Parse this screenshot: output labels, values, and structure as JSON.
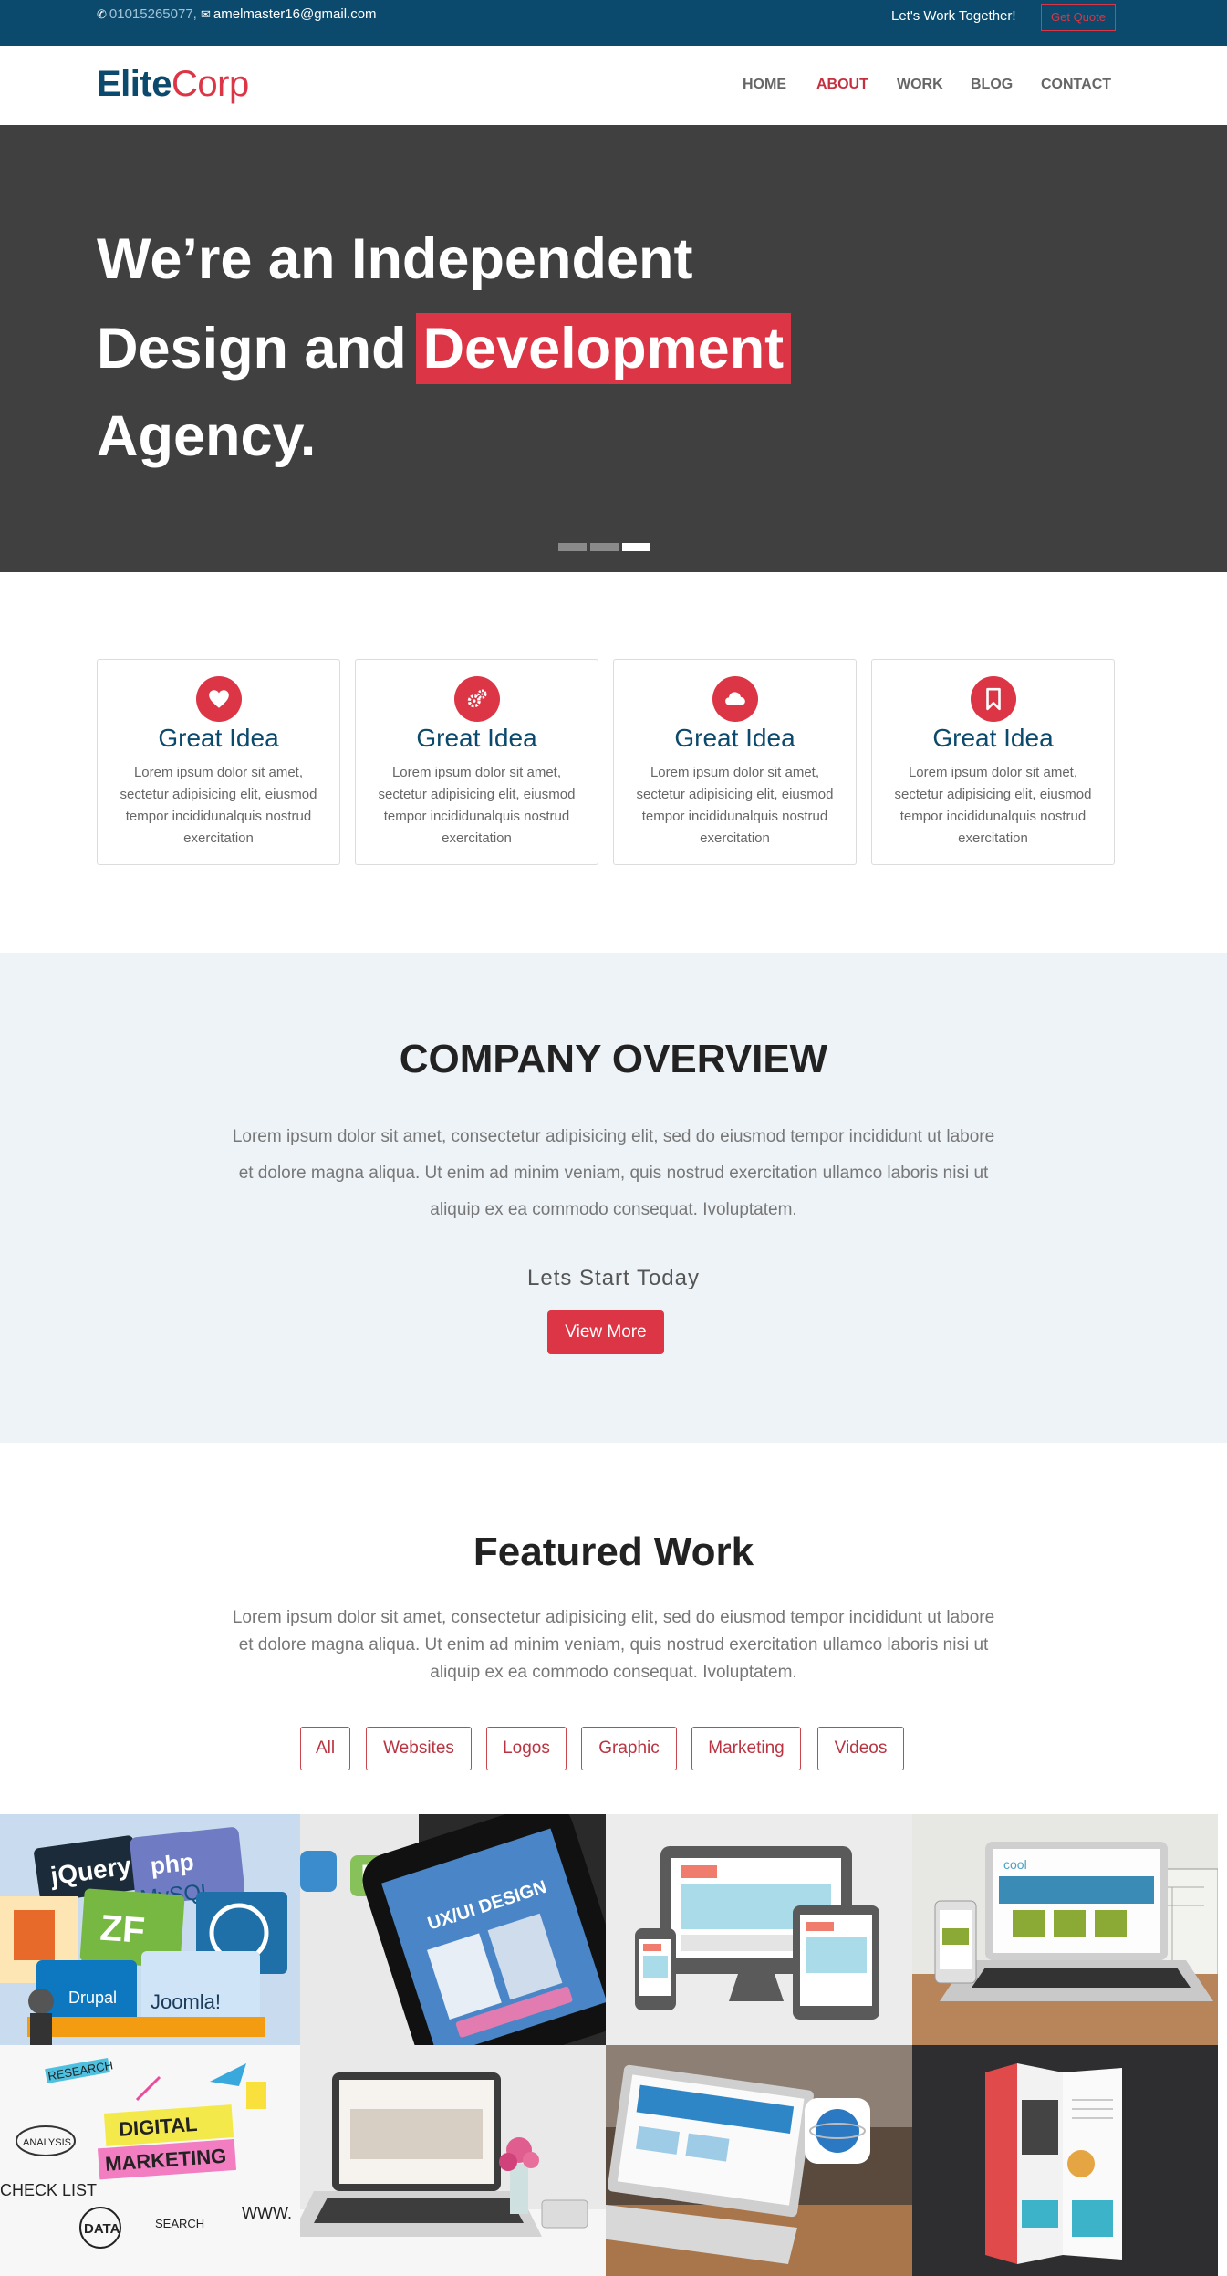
{
  "topbar": {
    "phone": "01015265077,",
    "email": "amelmaster16@gmail.com",
    "tagline": "Let's Work Together!",
    "quote_button": "Get Quote"
  },
  "nav": {
    "logo_part1": "Elite",
    "logo_part2": "Corp",
    "items": [
      "HOME",
      "ABOUT",
      "WORK",
      "BLOG",
      "CONTACT"
    ],
    "active": "ABOUT"
  },
  "hero": {
    "line1": "We’re an Independent",
    "line2_prefix": "Design and",
    "line2_highlight": "Development",
    "line3": "Agency.",
    "slides": 3,
    "active_slide": 3
  },
  "features": [
    {
      "icon": "heart-icon",
      "title": "Great Idea",
      "text": "Lorem ipsum dolor sit amet, sectetur adipisicing elit, eiusmod tempor incididunalquis nostrud exercitation"
    },
    {
      "icon": "gears-icon",
      "title": "Great Idea",
      "text": "Lorem ipsum dolor sit amet, sectetur adipisicing elit, eiusmod tempor incididunalquis nostrud exercitation"
    },
    {
      "icon": "cloud-icon",
      "title": "Great Idea",
      "text": "Lorem ipsum dolor sit amet, sectetur adipisicing elit, eiusmod tempor incididunalquis nostrud exercitation"
    },
    {
      "icon": "bookmark-icon",
      "title": "Great Idea",
      "text": "Lorem ipsum dolor sit amet, sectetur adipisicing elit, eiusmod tempor incididunalquis nostrud exercitation"
    }
  ],
  "overview": {
    "title": "COMPANY OVERVIEW",
    "text": "Lorem ipsum dolor sit amet, consectetur adipisicing elit, sed do eiusmod tempor incididunt ut labore et dolore magna aliqua. Ut enim ad minim veniam, quis nostrud exercitation ullamco laboris nisi ut aliquip ex ea commodo consequat. Ivoluptatem.",
    "subtitle": "Lets Start Today",
    "button": "View More"
  },
  "featured": {
    "title": "Featured Work",
    "text": "Lorem ipsum dolor sit amet, consectetur adipisicing elit, sed do eiusmod tempor incididunt ut labore et dolore magna aliqua. Ut enim ad minim veniam, quis nostrud exercitation ullamco laboris nisi ut aliquip ex ea commodo consequat. Ivoluptatem.",
    "filters": [
      "All",
      "Websites",
      "Logos",
      "Graphic",
      "Marketing",
      "Videos"
    ],
    "tiles": [
      {
        "caption_words": [
          "jQuery",
          "php",
          "MySQL",
          "ZF",
          "Drupal",
          "Joomla!"
        ]
      },
      {
        "caption_words": [
          "UX/UI DESIGN"
        ]
      },
      {
        "caption_words": []
      },
      {
        "caption_words": [
          "cool"
        ]
      },
      {
        "caption_words": [
          "DIGITAL",
          "MARKETING",
          "RESEARCH",
          "ANALYSIS",
          "CHECK LIST",
          "DATA",
          "SEARCH",
          "WWW."
        ]
      },
      {
        "caption_words": []
      },
      {
        "caption_words": []
      },
      {
        "caption_words": []
      }
    ]
  },
  "colors": {
    "primary": "#dc3545",
    "navy": "#0b4a6c",
    "hero_bg": "#404040",
    "overview_bg": "#eef3f7"
  }
}
